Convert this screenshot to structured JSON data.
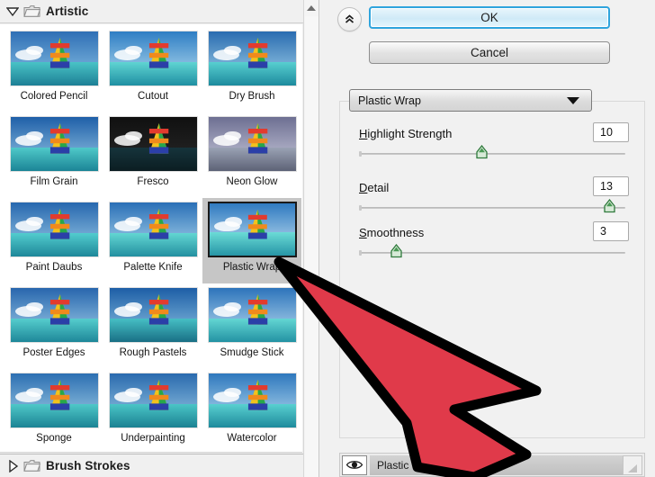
{
  "window": {
    "app": "Filter Gallery"
  },
  "left_panel": {
    "category": {
      "label": "Artistic",
      "expanded_icon": "triangle-down-icon",
      "folder_icon": "folder-icon"
    },
    "category_next": {
      "label": "Brush Strokes",
      "collapsed_icon": "triangle-right-icon",
      "folder_icon": "folder-icon"
    },
    "scrollbar": {
      "up_icon": "scroll-up-arrow-icon"
    },
    "filters": [
      {
        "label": "Colored Pencil",
        "selected": false
      },
      {
        "label": "Cutout",
        "selected": false
      },
      {
        "label": "Dry Brush",
        "selected": false
      },
      {
        "label": "Film Grain",
        "selected": false
      },
      {
        "label": "Fresco",
        "selected": false
      },
      {
        "label": "Neon Glow",
        "selected": false
      },
      {
        "label": "Paint Daubs",
        "selected": false
      },
      {
        "label": "Palette Knife",
        "selected": false
      },
      {
        "label": "Plastic Wrap",
        "selected": true
      },
      {
        "label": "Poster Edges",
        "selected": false
      },
      {
        "label": "Rough Pastels",
        "selected": false
      },
      {
        "label": "Smudge Stick",
        "selected": false
      },
      {
        "label": "Sponge",
        "selected": false
      },
      {
        "label": "Underpainting",
        "selected": false
      },
      {
        "label": "Watercolor",
        "selected": false
      }
    ]
  },
  "right_panel": {
    "collapse_button": {
      "icon": "double-chevron-up-icon"
    },
    "ok_label": "OK",
    "cancel_label": "Cancel",
    "filter_select": {
      "value": "Plastic Wrap",
      "caret_icon": "chevron-down-icon"
    },
    "sliders": [
      {
        "label": "Highlight Strength",
        "accel": "H",
        "rest": "ighlight Strength",
        "value": "10",
        "percent": 46
      },
      {
        "label": "Detail",
        "accel": "D",
        "rest": "etail",
        "value": "13",
        "percent": 94
      },
      {
        "label": "Smoothness",
        "accel": "S",
        "rest": "moothness",
        "value": "3",
        "percent": 14
      }
    ],
    "layers": {
      "visibility_icon": "eye-icon",
      "name": "Plastic Wrap",
      "resize_icon": "resize-grip-icon"
    }
  },
  "overlay": {
    "cursor": {
      "icon": "arrow-cursor",
      "fill": "#e03a4a",
      "stroke": "#000000"
    }
  },
  "colors": {
    "ok_border": "#2fa4dd",
    "panel_bg": "#f1f1f1",
    "grid_bg": "#ffffff",
    "selection_bg": "#c6c6c6",
    "slider_knob": "#4a9a55"
  }
}
